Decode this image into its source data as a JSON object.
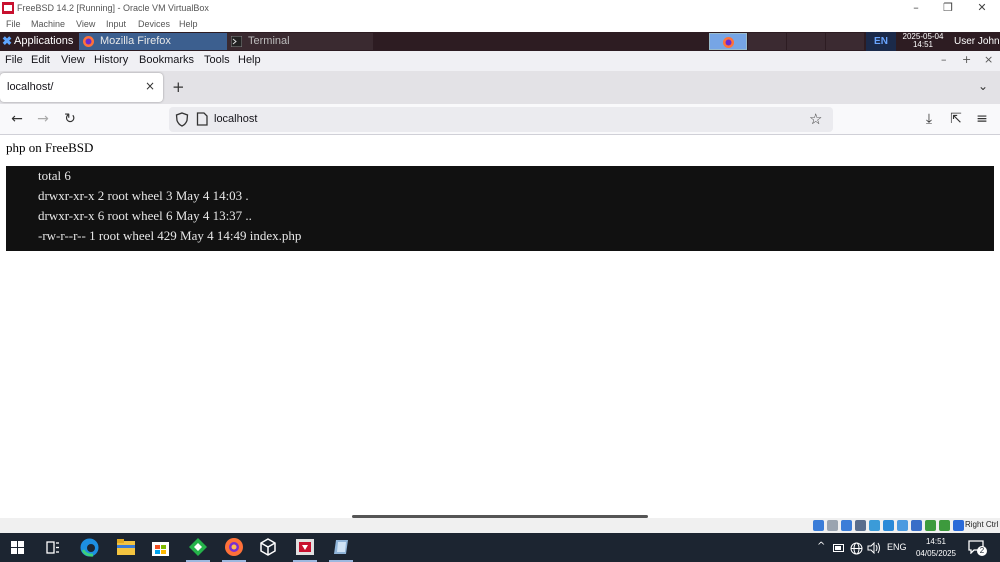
{
  "host_window": {
    "title": "FreeBSD 14.2 [Running] - Oracle VM VirtualBox",
    "menu": [
      "File",
      "Machine",
      "View",
      "Input",
      "Devices",
      "Help"
    ],
    "controls": {
      "minimize": "–",
      "restore": "❐",
      "close": "✕"
    }
  },
  "guest_panel": {
    "applications_label": "Applications :",
    "tasks": [
      {
        "label": "Mozilla Firefox",
        "icon": "firefox-icon",
        "active": true
      },
      {
        "label": "Terminal",
        "icon": "terminal-icon",
        "active": false
      }
    ],
    "keyboard_layout": "EN",
    "clock_date": "2025-05-04",
    "clock_time": "14:51",
    "user": "User John"
  },
  "browser": {
    "menu": [
      "File",
      "Edit",
      "View",
      "History",
      "Bookmarks",
      "Tools",
      "Help"
    ],
    "window_controls": {
      "minimize": "–",
      "maximize": "+",
      "close": "×"
    },
    "tab": {
      "title": "localhost/",
      "close": "×"
    },
    "new_tab": "+",
    "list_tabs": "⌄",
    "nav": {
      "back": "←",
      "forward": "→",
      "reload": "↻"
    },
    "url": "localhost",
    "bookmark_star": "☆",
    "toolbar_right": {
      "downloads": "⤓",
      "extensions": "⇱",
      "menu": "≡"
    }
  },
  "page": {
    "heading": "php on FreeBSD",
    "lines": [
      "total 6",
      "drwxr-xr-x 2 root wheel 3 May 4 14:03 .",
      "drwxr-xr-x 6 root wheel 6 May 4 13:37 ..",
      "-rw-r--r-- 1 root wheel 429 May 4 14:49 index.php"
    ]
  },
  "vbox_status": {
    "host_key": "Right Ctrl",
    "icon_colors": [
      "#3b7dd8",
      "#9aa4b0",
      "#3b7dd8",
      "#5a6e8c",
      "#3b9bd8",
      "#2a8ad8",
      "#4a9ae0",
      "#3a6ec8",
      "#3d9a3d",
      "#3d9a3d",
      "#2a6ad8"
    ]
  },
  "windows_taskbar": {
    "tray_chevron": "^",
    "language": "ENG",
    "time": "14:51",
    "date": "04/05/2025",
    "notifications": "2"
  },
  "colors": {
    "guest_panel_bg": "#2d1c22",
    "firefox_task_bg": "#3c5f8f",
    "pre_bg": "#111111",
    "win_taskbar_bg": "#1c2531"
  }
}
